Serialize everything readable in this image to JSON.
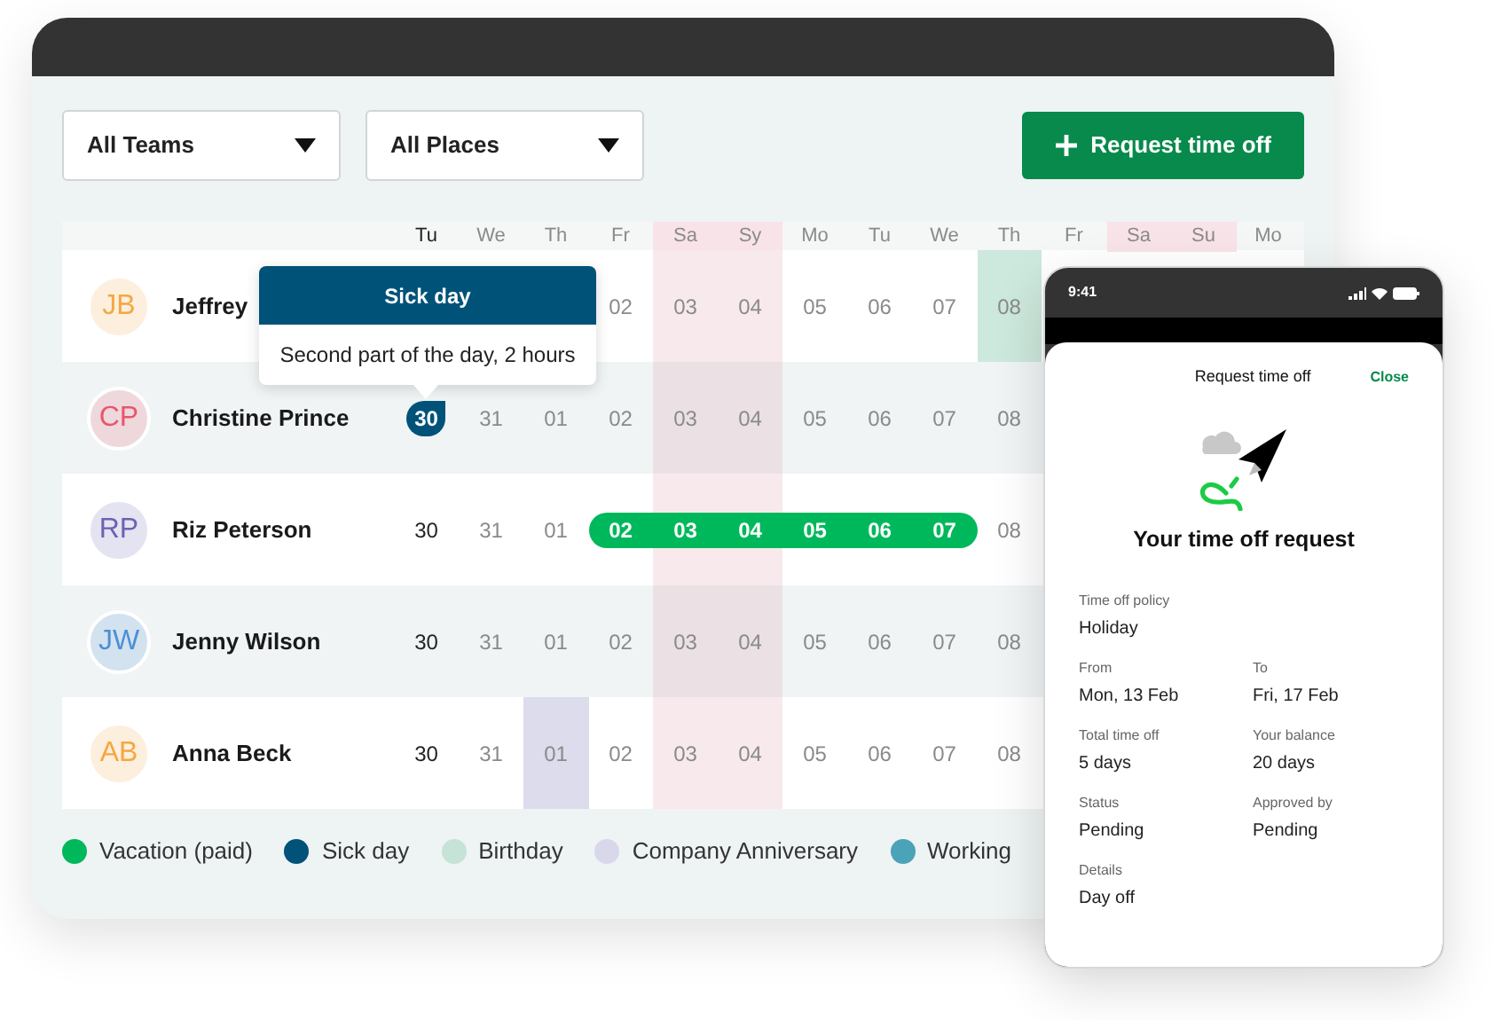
{
  "filters": [
    {
      "label": "All Teams"
    },
    {
      "label": "All Places"
    }
  ],
  "request_button": {
    "label": "Request time off"
  },
  "calendar": {
    "days": [
      {
        "label": "Tu",
        "weekend": false,
        "today": true
      },
      {
        "label": "We",
        "weekend": false,
        "today": false
      },
      {
        "label": "Th",
        "weekend": false,
        "today": false
      },
      {
        "label": "Fr",
        "weekend": false,
        "today": false
      },
      {
        "label": "Sa",
        "weekend": true,
        "today": false
      },
      {
        "label": "Sy",
        "weekend": true,
        "today": false
      },
      {
        "label": "Mo",
        "weekend": false,
        "today": false
      },
      {
        "label": "Tu",
        "weekend": false,
        "today": false
      },
      {
        "label": "We",
        "weekend": false,
        "today": false
      },
      {
        "label": "Th",
        "weekend": false,
        "today": false
      },
      {
        "label": "Fr",
        "weekend": false,
        "today": false
      },
      {
        "label": "Sa",
        "weekend": true,
        "today": false
      },
      {
        "label": "Su",
        "weekend": true,
        "today": false
      },
      {
        "label": "Mo",
        "weekend": false,
        "today": false
      }
    ],
    "rows": [
      {
        "initials": "JB",
        "name": "Jeffrey",
        "color": "#f5a742",
        "days": [
          {
            "text": "02",
            "kind": "plain"
          },
          {
            "text": "03",
            "kind": "plain"
          },
          {
            "text": "04",
            "kind": "plain"
          },
          {
            "text": "05",
            "kind": "plain"
          },
          {
            "text": "06",
            "kind": "plain"
          },
          {
            "text": "07",
            "kind": "plain"
          },
          {
            "text": "08",
            "kind": "birthday"
          }
        ]
      },
      {
        "initials": "CP",
        "name": "Christine Prince",
        "color": "#e8566e",
        "days": [
          {
            "text": "30",
            "kind": "sick"
          },
          {
            "text": "31",
            "kind": "plain"
          },
          {
            "text": "01",
            "kind": "plain"
          },
          {
            "text": "02",
            "kind": "plain"
          },
          {
            "text": "03",
            "kind": "plain"
          },
          {
            "text": "04",
            "kind": "plain"
          },
          {
            "text": "05",
            "kind": "plain"
          },
          {
            "text": "06",
            "kind": "plain"
          },
          {
            "text": "07",
            "kind": "plain"
          },
          {
            "text": "08",
            "kind": "plain"
          }
        ]
      },
      {
        "initials": "RP",
        "name": "Riz Peterson",
        "color": "#6a62b4",
        "days": [
          {
            "text": "30",
            "kind": "plain"
          },
          {
            "text": "31",
            "kind": "plain"
          },
          {
            "text": "01",
            "kind": "plain"
          },
          {
            "text": "02",
            "kind": "vacation"
          },
          {
            "text": "03",
            "kind": "vacation"
          },
          {
            "text": "04",
            "kind": "vacation"
          },
          {
            "text": "05",
            "kind": "vacation"
          },
          {
            "text": "06",
            "kind": "vacation"
          },
          {
            "text": "07",
            "kind": "vacation"
          },
          {
            "text": "08",
            "kind": "plain"
          }
        ]
      },
      {
        "initials": "JW",
        "name": "Jenny Wilson",
        "color": "#4c8fd6",
        "days": [
          {
            "text": "30",
            "kind": "plain"
          },
          {
            "text": "31",
            "kind": "plain"
          },
          {
            "text": "01",
            "kind": "plain"
          },
          {
            "text": "02",
            "kind": "plain"
          },
          {
            "text": "03",
            "kind": "plain"
          },
          {
            "text": "04",
            "kind": "plain"
          },
          {
            "text": "05",
            "kind": "plain"
          },
          {
            "text": "06",
            "kind": "plain"
          },
          {
            "text": "07",
            "kind": "plain"
          },
          {
            "text": "08",
            "kind": "plain"
          }
        ]
      },
      {
        "initials": "AB",
        "name": "Anna Beck",
        "color": "#f5a742",
        "days": [
          {
            "text": "30",
            "kind": "plain"
          },
          {
            "text": "31",
            "kind": "plain"
          },
          {
            "text": "01",
            "kind": "anniversary"
          },
          {
            "text": "02",
            "kind": "plain"
          },
          {
            "text": "03",
            "kind": "plain"
          },
          {
            "text": "04",
            "kind": "plain"
          },
          {
            "text": "05",
            "kind": "plain"
          },
          {
            "text": "06",
            "kind": "plain"
          },
          {
            "text": "07",
            "kind": "plain"
          },
          {
            "text": "08",
            "kind": "plain"
          }
        ]
      }
    ]
  },
  "tooltip": {
    "title": "Sick day",
    "text": "Second part of the day, 2 hours"
  },
  "legend": [
    {
      "label": "Vacation (paid)",
      "color": "#00b85c"
    },
    {
      "label": "Sick day",
      "color": "#005279"
    },
    {
      "label": "Birthday",
      "color": "#c5e3d6"
    },
    {
      "label": "Company Anniversary",
      "color": "#d8d8ea"
    },
    {
      "label": "Working",
      "color": "#4aa3b8"
    }
  ],
  "phone": {
    "time": "9:41",
    "title": "Request time off",
    "close": "Close",
    "heading": "Your time off request",
    "fields": [
      {
        "label": "Time off policy",
        "value": "Holiday",
        "kind": "full"
      },
      {
        "label": "From",
        "value": "Mon, 13 Feb",
        "kind": "half"
      },
      {
        "label": "To",
        "value": "Fri, 17 Feb",
        "kind": "half"
      },
      {
        "label": "Total time off",
        "value": "5 days",
        "kind": "half"
      },
      {
        "label": "Your balance",
        "value": "20 days",
        "kind": "half"
      },
      {
        "label": "Status",
        "value": "Pending",
        "kind": "half"
      },
      {
        "label": "Approved by",
        "value": "Pending",
        "kind": "half"
      },
      {
        "label": "Details",
        "value": "Day off",
        "kind": "full"
      }
    ]
  }
}
